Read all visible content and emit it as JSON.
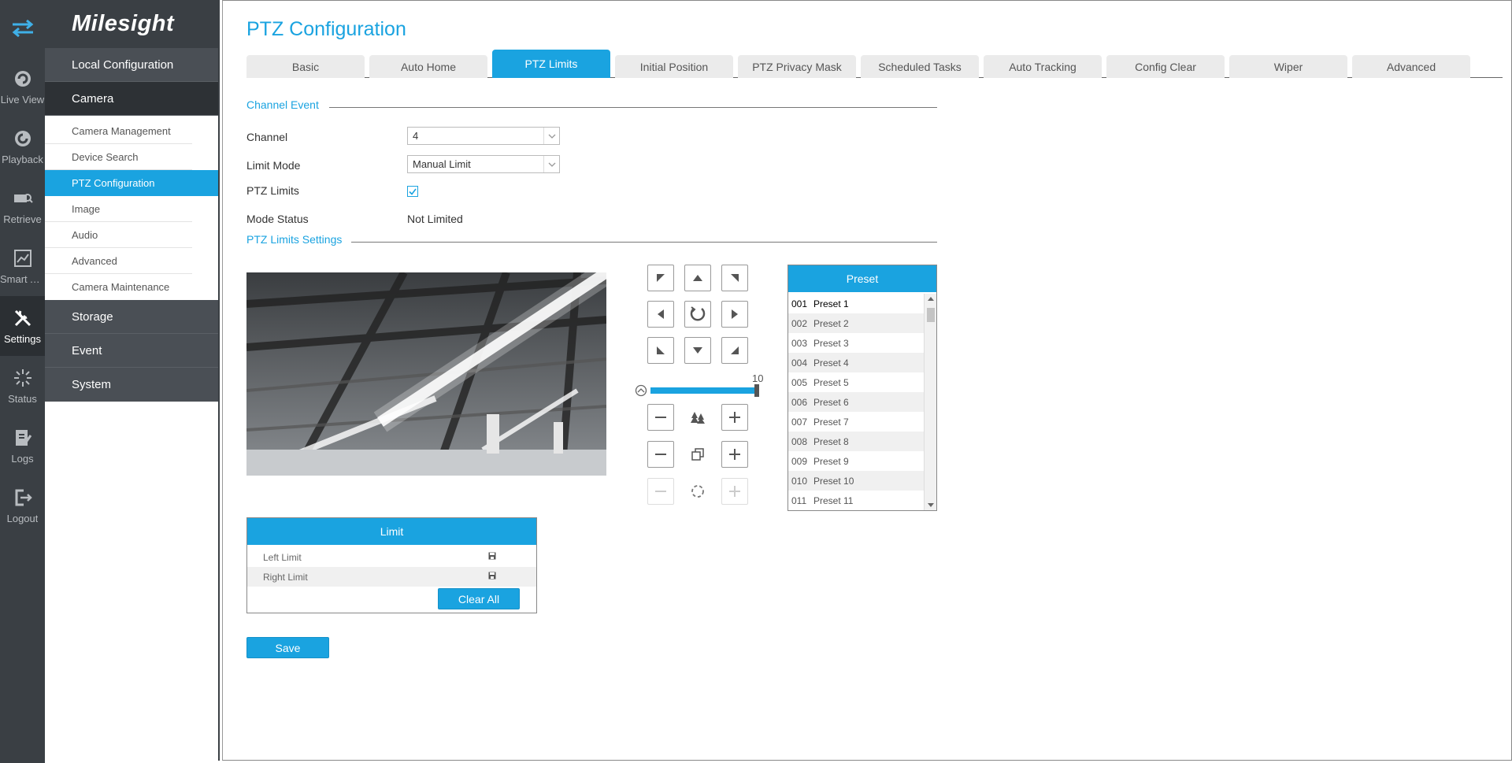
{
  "brand": {
    "name": "Milesight"
  },
  "rail": {
    "items": [
      {
        "label": "Live View",
        "icon": "live-view-icon"
      },
      {
        "label": "Playback",
        "icon": "playback-icon"
      },
      {
        "label": "Retrieve",
        "icon": "retrieve-icon"
      },
      {
        "label": "Smart A...",
        "icon": "smart-analytics-icon"
      },
      {
        "label": "Settings",
        "icon": "settings-icon"
      },
      {
        "label": "Status",
        "icon": "status-icon"
      },
      {
        "label": "Logs",
        "icon": "logs-icon"
      },
      {
        "label": "Logout",
        "icon": "logout-icon"
      }
    ]
  },
  "menu": {
    "local_configuration": "Local Configuration",
    "camera": "Camera",
    "camera_items": [
      "Camera Management",
      "Device Search",
      "PTZ Configuration",
      "Image",
      "Audio",
      "Advanced",
      "Camera Maintenance"
    ],
    "storage": "Storage",
    "event": "Event",
    "system": "System"
  },
  "page": {
    "title": "PTZ Configuration"
  },
  "tabs": [
    "Basic",
    "Auto Home",
    "PTZ Limits",
    "Initial Position",
    "PTZ Privacy Mask",
    "Scheduled Tasks",
    "Auto Tracking",
    "Config Clear",
    "Wiper",
    "Advanced"
  ],
  "channel_event": {
    "title": "Channel Event",
    "channel_label": "Channel",
    "channel_value": "4",
    "limit_mode_label": "Limit Mode",
    "limit_mode_value": "Manual Limit",
    "ptz_limits_label": "PTZ Limits",
    "ptz_limits_checked": true,
    "mode_status_label": "Mode Status",
    "mode_status_value": "Not Limited"
  },
  "ptz_limits_settings": {
    "title": "PTZ Limits Settings"
  },
  "ptz": {
    "speed_value": "10",
    "speed_fraction": 1.0
  },
  "preset": {
    "title": "Preset",
    "items": [
      {
        "num": "001",
        "name": "Preset 1"
      },
      {
        "num": "002",
        "name": "Preset 2"
      },
      {
        "num": "003",
        "name": "Preset 3"
      },
      {
        "num": "004",
        "name": "Preset 4"
      },
      {
        "num": "005",
        "name": "Preset 5"
      },
      {
        "num": "006",
        "name": "Preset 6"
      },
      {
        "num": "007",
        "name": "Preset 7"
      },
      {
        "num": "008",
        "name": "Preset 8"
      },
      {
        "num": "009",
        "name": "Preset 9"
      },
      {
        "num": "010",
        "name": "Preset 10"
      },
      {
        "num": "011",
        "name": "Preset 11"
      }
    ]
  },
  "limit": {
    "title": "Limit",
    "left_limit": "Left Limit",
    "right_limit": "Right Limit",
    "clear_all": "Clear All"
  },
  "actions": {
    "save": "Save"
  },
  "colors": {
    "accent": "#1aa3e0",
    "rail": "#3a3f44"
  }
}
